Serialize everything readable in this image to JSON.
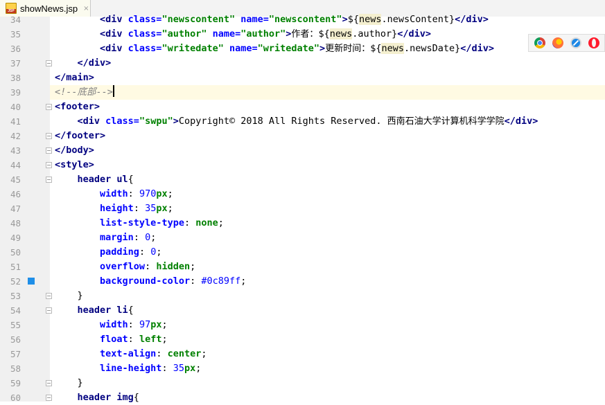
{
  "tab": {
    "icon_text": "JSP",
    "label": "showNews.jsp",
    "close": "×"
  },
  "current_line": 39,
  "marker_line": 52,
  "lines": [
    {
      "n": "34",
      "fold": false,
      "tokens": [
        [
          "el",
          "        "
        ],
        [
          "t",
          "<div "
        ],
        [
          "an",
          "class="
        ],
        [
          "av",
          "\"newscontent\" "
        ],
        [
          "an",
          "name="
        ],
        [
          "av",
          "\"newscontent\""
        ],
        [
          "t",
          ">"
        ],
        [
          "el",
          "${"
        ],
        [
          "nw",
          "news"
        ],
        [
          "el",
          ".newsContent}"
        ],
        [
          "t",
          "</div>"
        ]
      ]
    },
    {
      "n": "35",
      "fold": false,
      "tokens": [
        [
          "el",
          "        "
        ],
        [
          "t",
          "<div "
        ],
        [
          "an",
          "class="
        ],
        [
          "av",
          "\"author\" "
        ],
        [
          "an",
          "name="
        ],
        [
          "av",
          "\"author\""
        ],
        [
          "t",
          ">"
        ],
        [
          "zh",
          "作者："
        ],
        [
          "el",
          "${"
        ],
        [
          "nw",
          "news"
        ],
        [
          "el",
          ".author}"
        ],
        [
          "t",
          "</div>"
        ]
      ]
    },
    {
      "n": "36",
      "fold": false,
      "tokens": [
        [
          "el",
          "        "
        ],
        [
          "t",
          "<div "
        ],
        [
          "an",
          "class="
        ],
        [
          "av",
          "\"writedate\" "
        ],
        [
          "an",
          "name="
        ],
        [
          "av",
          "\"writedate\""
        ],
        [
          "t",
          ">"
        ],
        [
          "zh",
          "更新时间："
        ],
        [
          "el",
          "${"
        ],
        [
          "nw",
          "news"
        ],
        [
          "el",
          ".newsDate}"
        ],
        [
          "t",
          "</div>"
        ]
      ]
    },
    {
      "n": "37",
      "fold": true,
      "tokens": [
        [
          "el",
          "    "
        ],
        [
          "t",
          "</div>"
        ]
      ]
    },
    {
      "n": "38",
      "fold": false,
      "tokens": [
        [
          "t",
          "</main>"
        ]
      ]
    },
    {
      "n": "39",
      "fold": false,
      "tokens": [
        [
          "cm",
          "<!--"
        ],
        [
          "cz",
          "底部"
        ],
        [
          "cm",
          "-->"
        ]
      ]
    },
    {
      "n": "40",
      "fold": true,
      "tokens": [
        [
          "t",
          "<footer>"
        ]
      ]
    },
    {
      "n": "41",
      "fold": false,
      "tokens": [
        [
          "el",
          "    "
        ],
        [
          "t",
          "<div "
        ],
        [
          "an",
          "class="
        ],
        [
          "av",
          "\"swpu\""
        ],
        [
          "t",
          ">"
        ],
        [
          "el",
          "Copyright© 2018 All Rights Reserved. "
        ],
        [
          "zh",
          "西南石油大学计算机科学学院"
        ],
        [
          "t",
          "</div>"
        ]
      ]
    },
    {
      "n": "42",
      "fold": true,
      "tokens": [
        [
          "t",
          "</footer>"
        ]
      ]
    },
    {
      "n": "43",
      "fold": true,
      "tokens": [
        [
          "t",
          "</body>"
        ]
      ]
    },
    {
      "n": "44",
      "fold": true,
      "tokens": [
        [
          "t",
          "<style>"
        ]
      ]
    },
    {
      "n": "45",
      "fold": true,
      "tokens": [
        [
          "el",
          "    "
        ],
        [
          "sel",
          "header ul"
        ],
        [
          "punc",
          "{"
        ]
      ]
    },
    {
      "n": "46",
      "fold": false,
      "tokens": [
        [
          "el",
          "        "
        ],
        [
          "prop",
          "width"
        ],
        [
          "punc",
          ": "
        ],
        [
          "num",
          "970"
        ],
        [
          "unit",
          "px"
        ],
        [
          "punc",
          ";"
        ]
      ]
    },
    {
      "n": "47",
      "fold": false,
      "tokens": [
        [
          "el",
          "        "
        ],
        [
          "prop",
          "height"
        ],
        [
          "punc",
          ": "
        ],
        [
          "num",
          "35"
        ],
        [
          "unit",
          "px"
        ],
        [
          "punc",
          ";"
        ]
      ]
    },
    {
      "n": "48",
      "fold": false,
      "tokens": [
        [
          "el",
          "        "
        ],
        [
          "prop",
          "list-style-type"
        ],
        [
          "punc",
          ": "
        ],
        [
          "val",
          "none"
        ],
        [
          "punc",
          ";"
        ]
      ]
    },
    {
      "n": "49",
      "fold": false,
      "tokens": [
        [
          "el",
          "        "
        ],
        [
          "prop",
          "margin"
        ],
        [
          "punc",
          ": "
        ],
        [
          "num",
          "0"
        ],
        [
          "punc",
          ";"
        ]
      ]
    },
    {
      "n": "50",
      "fold": false,
      "tokens": [
        [
          "el",
          "        "
        ],
        [
          "prop",
          "padding"
        ],
        [
          "punc",
          ": "
        ],
        [
          "num",
          "0"
        ],
        [
          "punc",
          ";"
        ]
      ]
    },
    {
      "n": "51",
      "fold": false,
      "tokens": [
        [
          "el",
          "        "
        ],
        [
          "prop",
          "overflow"
        ],
        [
          "punc",
          ": "
        ],
        [
          "val",
          "hidden"
        ],
        [
          "punc",
          ";"
        ]
      ]
    },
    {
      "n": "52",
      "fold": false,
      "tokens": [
        [
          "el",
          "        "
        ],
        [
          "prop",
          "background-color"
        ],
        [
          "punc",
          ": "
        ],
        [
          "num",
          "#0c89ff"
        ],
        [
          "punc",
          ";"
        ]
      ]
    },
    {
      "n": "53",
      "fold": true,
      "tokens": [
        [
          "el",
          "    "
        ],
        [
          "punc",
          "}"
        ]
      ]
    },
    {
      "n": "54",
      "fold": true,
      "tokens": [
        [
          "el",
          "    "
        ],
        [
          "sel",
          "header li"
        ],
        [
          "punc",
          "{"
        ]
      ]
    },
    {
      "n": "55",
      "fold": false,
      "tokens": [
        [
          "el",
          "        "
        ],
        [
          "prop",
          "width"
        ],
        [
          "punc",
          ": "
        ],
        [
          "num",
          "97"
        ],
        [
          "unit",
          "px"
        ],
        [
          "punc",
          ";"
        ]
      ]
    },
    {
      "n": "56",
      "fold": false,
      "tokens": [
        [
          "el",
          "        "
        ],
        [
          "prop",
          "float"
        ],
        [
          "punc",
          ": "
        ],
        [
          "val",
          "left"
        ],
        [
          "punc",
          ";"
        ]
      ]
    },
    {
      "n": "57",
      "fold": false,
      "tokens": [
        [
          "el",
          "        "
        ],
        [
          "prop",
          "text-align"
        ],
        [
          "punc",
          ": "
        ],
        [
          "val",
          "center"
        ],
        [
          "punc",
          ";"
        ]
      ]
    },
    {
      "n": "58",
      "fold": false,
      "tokens": [
        [
          "el",
          "        "
        ],
        [
          "prop",
          "line-height"
        ],
        [
          "punc",
          ": "
        ],
        [
          "num",
          "35"
        ],
        [
          "unit",
          "px"
        ],
        [
          "punc",
          ";"
        ]
      ]
    },
    {
      "n": "59",
      "fold": true,
      "tokens": [
        [
          "el",
          "    "
        ],
        [
          "punc",
          "}"
        ]
      ]
    },
    {
      "n": "60",
      "fold": true,
      "tokens": [
        [
          "el",
          "    "
        ],
        [
          "sel",
          "header img"
        ],
        [
          "punc",
          "{"
        ]
      ]
    }
  ],
  "browsers": [
    "chrome-icon",
    "firefox-icon",
    "safari-icon",
    "opera-icon"
  ]
}
